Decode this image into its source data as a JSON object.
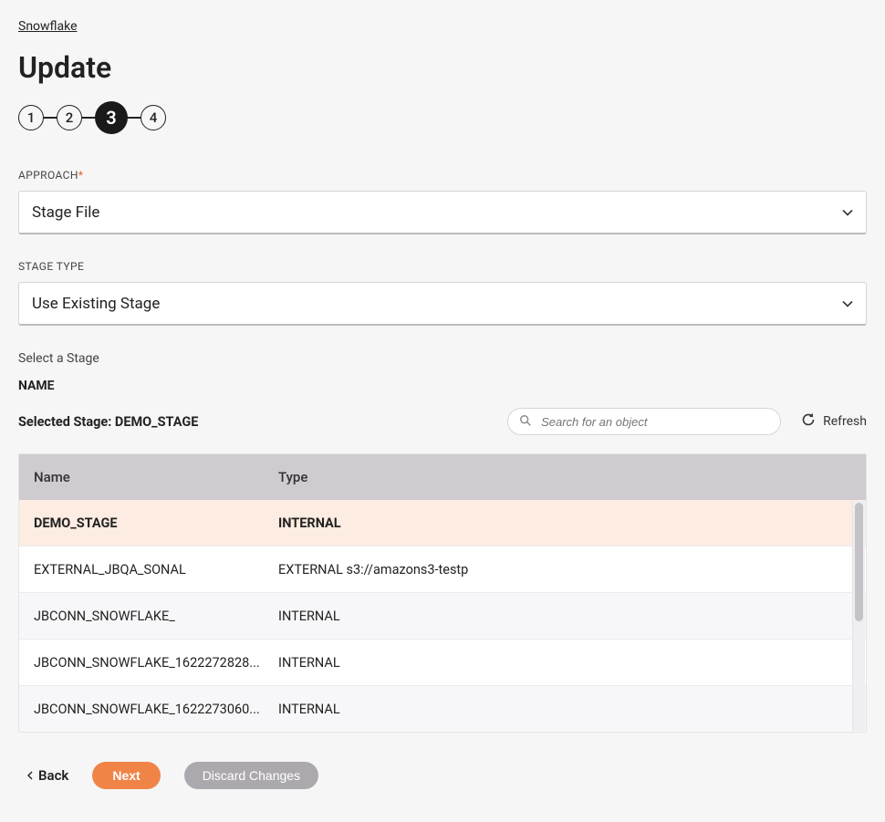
{
  "breadcrumb": "Snowflake",
  "page_title": "Update",
  "stepper": {
    "steps": [
      "1",
      "2",
      "3",
      "4"
    ],
    "active_index": 2
  },
  "approach": {
    "label": "APPROACH",
    "required_marker": "*",
    "value": "Stage File"
  },
  "stage_type": {
    "label": "STAGE TYPE",
    "value": "Use Existing Stage"
  },
  "select_stage_label": "Select a Stage",
  "name_heading": "NAME",
  "selected_stage_prefix": "Selected Stage: ",
  "selected_stage_value": "DEMO_STAGE",
  "search": {
    "placeholder": "Search for an object"
  },
  "refresh_label": "Refresh",
  "table": {
    "columns": {
      "name": "Name",
      "type": "Type"
    },
    "rows": [
      {
        "name": "DEMO_STAGE",
        "type": "INTERNAL",
        "selected": true
      },
      {
        "name": "EXTERNAL_JBQA_SONAL",
        "type": "EXTERNAL s3://amazons3-testp",
        "selected": false
      },
      {
        "name": "JBCONN_SNOWFLAKE_",
        "type": "INTERNAL",
        "selected": false
      },
      {
        "name": "JBCONN_SNOWFLAKE_1622272828...",
        "type": "INTERNAL",
        "selected": false
      },
      {
        "name": "JBCONN_SNOWFLAKE_1622273060...",
        "type": "INTERNAL",
        "selected": false
      }
    ]
  },
  "footer": {
    "back": "Back",
    "next": "Next",
    "discard": "Discard Changes"
  }
}
